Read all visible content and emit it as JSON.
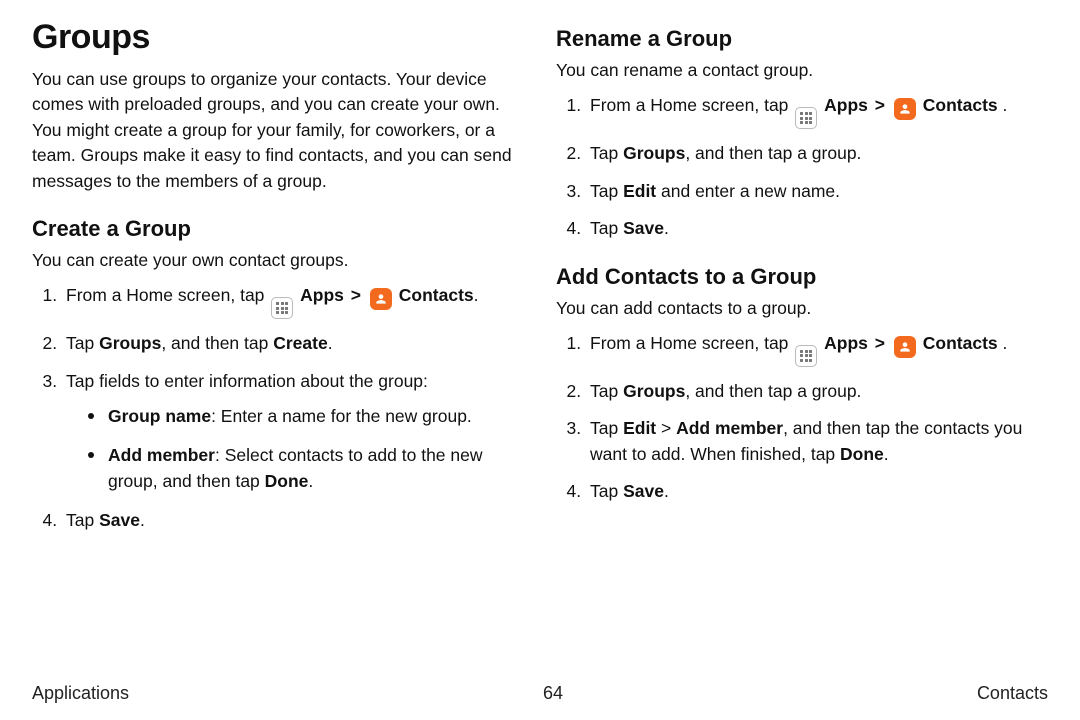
{
  "left": {
    "title": "Groups",
    "intro": "You can use groups to organize your contacts. Your device comes with preloaded groups, and you can create your own. You might create a group for your family, for coworkers, or a team. Groups make it easy to find contacts, and you can send messages to the members of a group.",
    "create": {
      "heading": "Create a Group",
      "desc": "You can create your own contact groups.",
      "step1": {
        "prefix": "From a Home screen, tap ",
        "apps": "Apps",
        "contacts": "Contacts",
        "suffix": "."
      },
      "step2": {
        "t1": "Tap ",
        "b1": "Groups",
        "t2": ", and then tap ",
        "b2": "Create",
        "t3": "."
      },
      "step3": "Tap fields to enter information about the group:",
      "bullets": {
        "a": {
          "b": "Group name",
          "t": ": Enter a name for the new group."
        },
        "b": {
          "b": "Add member",
          "t1": ": Select contacts to add to the new group, and then tap ",
          "b2": "Done",
          "t2": "."
        }
      },
      "step4": {
        "t1": "Tap ",
        "b": "Save",
        "t2": "."
      }
    }
  },
  "right": {
    "rename": {
      "heading": "Rename a Group",
      "desc": "You can rename a contact group.",
      "step1": {
        "prefix": "From a Home screen, tap ",
        "apps": "Apps",
        "contacts": "Contacts",
        "suffix": " ."
      },
      "step2": {
        "t1": "Tap ",
        "b": "Groups",
        "t2": ", and then tap a group."
      },
      "step3": {
        "t1": "Tap ",
        "b": "Edit",
        "t2": " and enter a new name."
      },
      "step4": {
        "t1": "Tap ",
        "b": "Save",
        "t2": "."
      }
    },
    "add": {
      "heading": "Add Contacts to a Group",
      "desc": "You can add contacts to a group.",
      "step1": {
        "prefix": "From a Home screen, tap ",
        "apps": "Apps",
        "contacts": "Contacts",
        "suffix": " ."
      },
      "step2": {
        "t1": "Tap ",
        "b": "Groups",
        "t2": ", and then tap a group."
      },
      "step3": {
        "t1": "Tap ",
        "b1": "Edit",
        "t2": " > ",
        "b2": "Add member",
        "t3": ", and then tap the contacts you want to add. When finished, tap ",
        "b3": "Done",
        "t4": "."
      },
      "step4": {
        "t1": "Tap ",
        "b": "Save",
        "t2": "."
      }
    }
  },
  "footer": {
    "left": "Applications",
    "center": "64",
    "right": "Contacts"
  },
  "chev": ">"
}
